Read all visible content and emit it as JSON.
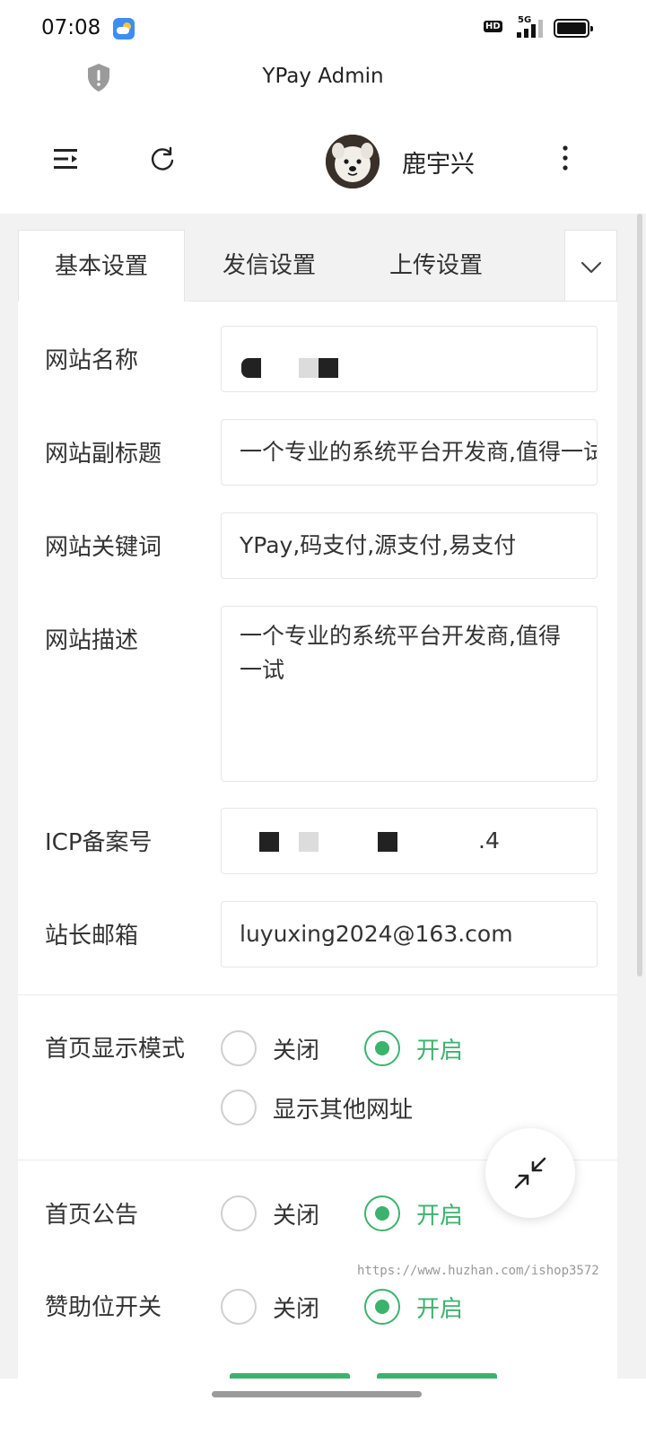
{
  "status_bar": {
    "time": "07:08",
    "weather_icon": "weather-cloud-sun-icon",
    "hd": "HD",
    "network": "5G"
  },
  "browser": {
    "title": "YPay Admin",
    "security_icon": "shield-alert-icon"
  },
  "header": {
    "menu_icon": "menu-collapse-icon",
    "refresh_icon": "refresh-icon",
    "username": "鹿宇兴",
    "more_icon": "more-vertical-icon"
  },
  "tabs": [
    {
      "label": "基本设置",
      "active": true
    },
    {
      "label": "发信设置",
      "active": false
    },
    {
      "label": "上传设置",
      "active": false
    }
  ],
  "form": {
    "site_name": {
      "label": "网站名称",
      "value": ""
    },
    "subtitle": {
      "label": "网站副标题",
      "value": "一个专业的系统平台开发商,值得一试"
    },
    "keywords": {
      "label": "网站关键词",
      "value": "YPay,码支付,源支付,易支付"
    },
    "description": {
      "label": "网站描述",
      "value": "一个专业的系统平台开发商,值得一试"
    },
    "icp": {
      "label": "ICP备案号",
      "value": ".4"
    },
    "email": {
      "label": "站长邮箱",
      "value": "luyuxing2024@163.com"
    }
  },
  "radios": {
    "home_mode": {
      "label": "首页显示模式",
      "options": [
        "关闭",
        "开启",
        "显示其他网址"
      ],
      "selected": "开启"
    },
    "notice": {
      "label": "首页公告",
      "options": [
        "关闭",
        "开启"
      ],
      "selected": "开启"
    },
    "sponsor": {
      "label": "赞助位开关",
      "options": [
        "关闭",
        "开启"
      ],
      "selected": "开启"
    }
  },
  "watermark": "https://www.huzhan.com/ishop3572",
  "colors": {
    "accent": "#3bb36d",
    "background": "#f2f2f2"
  }
}
